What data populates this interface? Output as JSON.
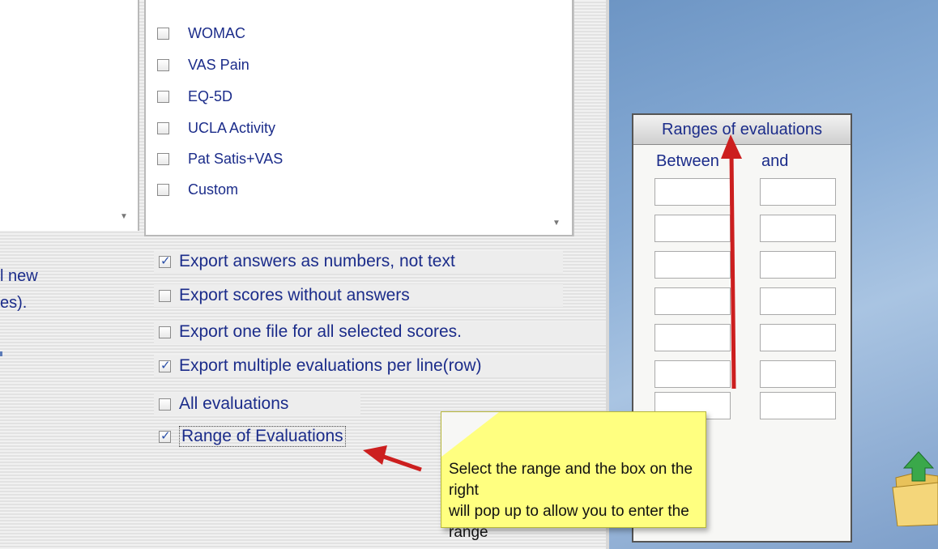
{
  "score_list": {
    "items": [
      {
        "label": "WOMAC",
        "checked": false
      },
      {
        "label": "VAS Pain",
        "checked": false
      },
      {
        "label": "EQ-5D",
        "checked": false
      },
      {
        "label": "UCLA Activity",
        "checked": false
      },
      {
        "label": "Pat Satis+VAS",
        "checked": false
      },
      {
        "label": "Custom",
        "checked": false
      }
    ]
  },
  "left_text": {
    "line1": "l new",
    "line2": "es)."
  },
  "options": [
    {
      "label": "Export answers as numbers, not text",
      "checked": true
    },
    {
      "label": "Export scores without answers",
      "checked": false
    },
    {
      "label": "Export one file for all selected scores.",
      "checked": false
    },
    {
      "label": "Export multiple evaluations per line(row)",
      "checked": true
    },
    {
      "label": "All evaluations",
      "checked": false
    },
    {
      "label": "Range of Evaluations",
      "checked": true
    }
  ],
  "ranges_panel": {
    "title": "Ranges of evaluations",
    "col_between": "Between",
    "col_and": "and",
    "row_count": 7
  },
  "callout": {
    "line1": "Select the range and the box on the right",
    "line2": "will pop up to allow you to enter the range"
  },
  "colors": {
    "text_blue": "#1b2c8a",
    "arrow_red": "#cc1f1f",
    "callout_yellow": "#ffff80"
  },
  "icons": [
    "folder-icon",
    "green-up-arrow-icon",
    "red-arrow-icon"
  ]
}
